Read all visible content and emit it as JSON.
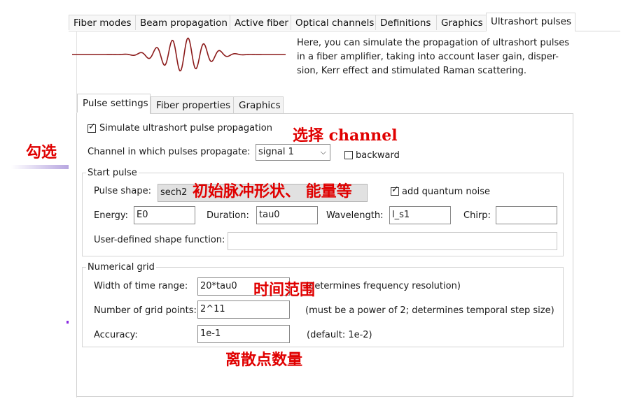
{
  "top_tabs": [
    "Fiber modes",
    "Beam propagation",
    "Active fiber",
    "Optical channels",
    "Definitions",
    "Graphics",
    "Ultrashort pulses"
  ],
  "description": "Here, you can simulate the propagation of ultrashort pulses in a fiber amplifier, taking into account laser gain, dispersion, Kerr effect and stimulated Raman scattering.",
  "desc_lines": [
    "Here, you can simulate the propagation of ultrashort pulses",
    "in a fiber amplifier, taking into account laser gain, disper-",
    "sion, Kerr effect and stimulated Raman scattering."
  ],
  "inner_tabs": [
    "Pulse settings",
    "Fiber properties",
    "Graphics"
  ],
  "simulate_checkbox": "Simulate ultrashort pulse propagation",
  "channel": {
    "label": "Channel in which pulses propagate:",
    "value": "signal 1",
    "backward": "backward"
  },
  "start_pulse": {
    "title": "Start pulse",
    "shape_label": "Pulse shape:",
    "shape_value": "sech2",
    "noise_label": "add quantum noise",
    "energy_label": "Energy:",
    "energy_value": "E0",
    "duration_label": "Duration:",
    "duration_value": "tau0",
    "wavelength_label": "Wavelength:",
    "wavelength_value": "l_s1",
    "chirp_label": "Chirp:",
    "chirp_value": "",
    "user_shape_label": "User-defined shape function:",
    "user_shape_value": ""
  },
  "numerical_grid": {
    "title": "Numerical grid",
    "width_label": "Width of time range:",
    "width_value": "20*tau0",
    "width_note": "(determines frequency resolution)",
    "points_label": "Number of grid points:",
    "points_value": "2^11",
    "points_note": "(must be a power of 2; determines temporal step size)",
    "accuracy_label": "Accuracy:",
    "accuracy_value": "1e-1",
    "accuracy_note": "(default: 1e-2)"
  },
  "annotations": {
    "check": "勾选",
    "select_channel": "选择 channel",
    "initial_pulse": "初始脉冲形状、 能量等",
    "time_range": "时间范围",
    "grid_points": "离散点数量"
  },
  "colors": {
    "annotation": "#e00000",
    "pulse_wave": "#8b1a1a",
    "highlight_bar": "#b7a6e0"
  }
}
